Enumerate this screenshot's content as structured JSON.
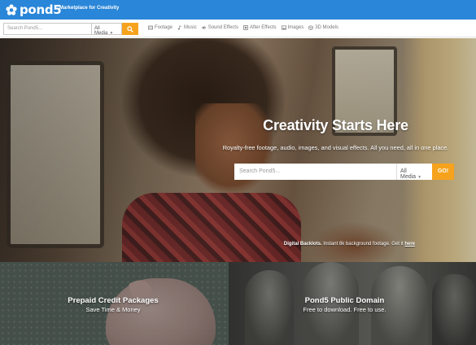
{
  "header": {
    "logo_text": "pond5",
    "tagline": "Marketplace for Creativity",
    "brand_color": "#2a86d8",
    "accent_color": "#f6a21d"
  },
  "search_bar": {
    "placeholder": "Search Pond5...",
    "media_select": "All Media",
    "go_icon": "search-icon"
  },
  "media_nav": [
    {
      "label": "Footage",
      "icon": "film-icon"
    },
    {
      "label": "Music",
      "icon": "music-icon"
    },
    {
      "label": "Sound Effects",
      "icon": "speaker-icon"
    },
    {
      "label": "After Effects",
      "icon": "layers-icon"
    },
    {
      "label": "Images",
      "icon": "image-icon"
    },
    {
      "label": "3D Models",
      "icon": "cube-icon"
    }
  ],
  "hero": {
    "title": "Creativity Starts Here",
    "subtitle": "Royalty-free footage, audio, images, and visual effects. All you need, all in one place.",
    "search_placeholder": "Search Pond5...",
    "media_select": "All Media",
    "go_label": "GO!",
    "backlot_bold": "Digital Backlots.",
    "backlot_text": " Instant 8k background footage. Get it ",
    "backlot_link": "here"
  },
  "tiles": [
    {
      "title": "Prepaid Credit Packages",
      "subtitle": "Save Time & Money"
    },
    {
      "title": "Pond5 Public Domain",
      "subtitle": "Free to download. Free to use."
    }
  ]
}
